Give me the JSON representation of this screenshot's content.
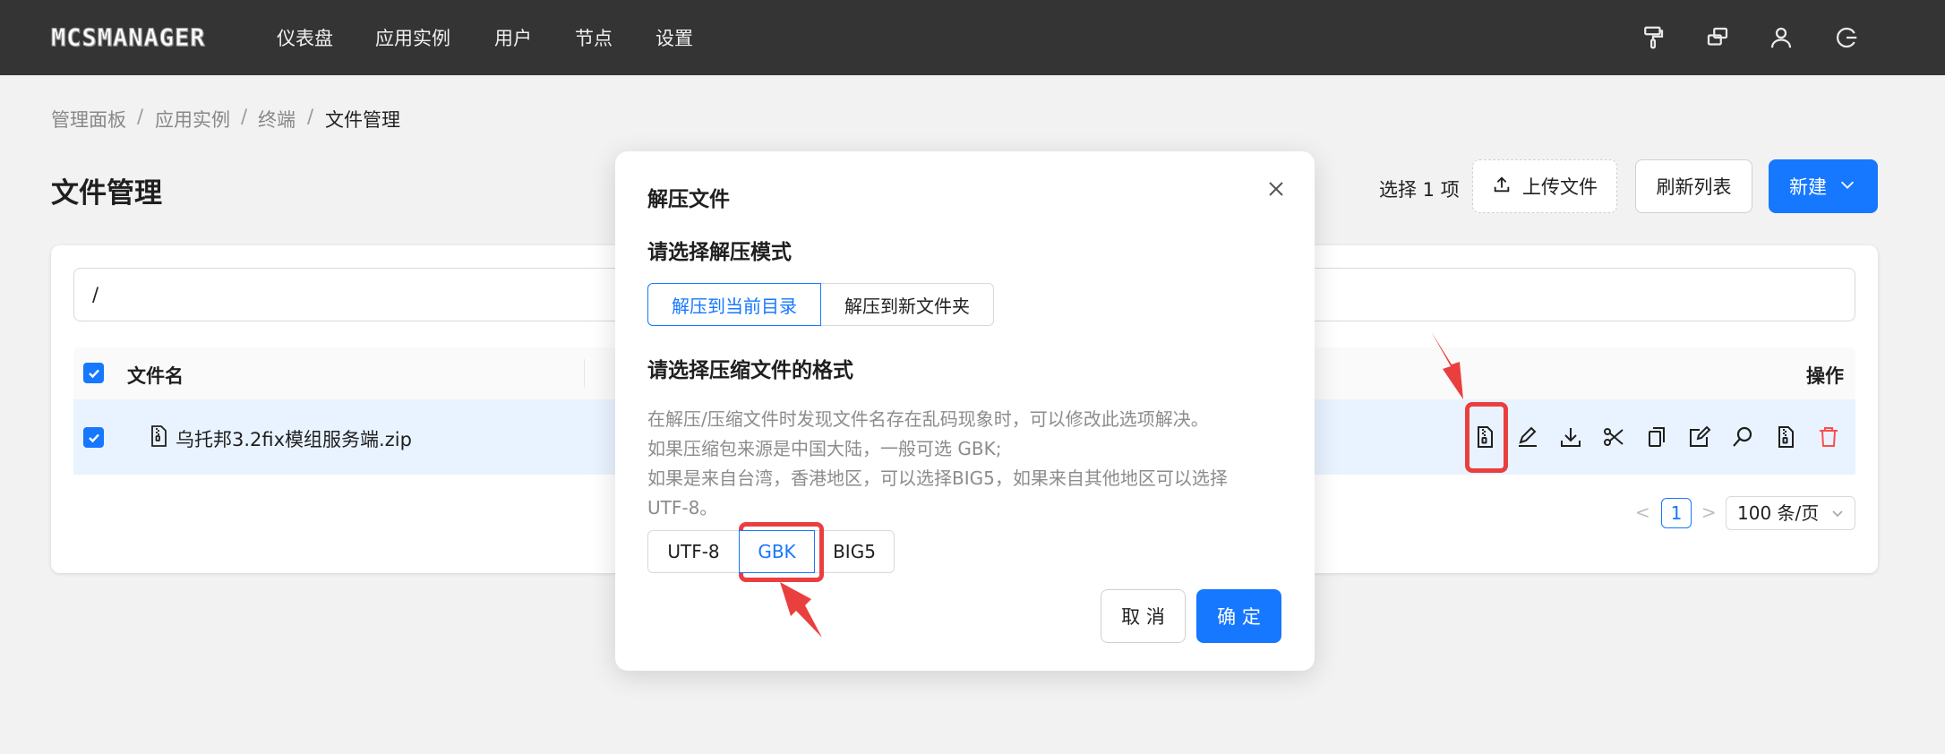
{
  "app": {
    "logo": "MCSMANAGER"
  },
  "nav": {
    "items": [
      "仪表盘",
      "应用实例",
      "用户",
      "节点",
      "设置"
    ]
  },
  "top_icons": [
    "paint-roller-icon",
    "layout-icon",
    "user-icon",
    "logout-icon"
  ],
  "breadcrumb": {
    "items": [
      "管理面板",
      "应用实例",
      "终端",
      "文件管理"
    ],
    "separator": "/"
  },
  "page": {
    "title": "文件管理"
  },
  "toolbar": {
    "selected": "选择 1 项",
    "upload": "上传文件",
    "refresh": "刷新列表",
    "new": "新建"
  },
  "file_panel": {
    "path": "/",
    "columns": {
      "name": "文件名",
      "actions": "操作"
    },
    "rows": [
      {
        "name": "乌托邦3.2fix模组服务端.zip",
        "checked": true
      }
    ],
    "row_actions": [
      "unzip-icon",
      "rename-icon",
      "download-icon",
      "cut-icon",
      "copy-icon",
      "edit-icon",
      "search-icon",
      "zip-icon",
      "delete-icon"
    ]
  },
  "pagination": {
    "prev": "<",
    "next": ">",
    "current": "1",
    "page_size": "100 条/页"
  },
  "modal": {
    "title": "解压文件",
    "mode_heading": "请选择解压模式",
    "modes": [
      "解压到当前目录",
      "解压到新文件夹"
    ],
    "mode_selected": "解压到当前目录",
    "format_heading": "请选择压缩文件的格式",
    "description": [
      "在解压/压缩文件时发现文件名存在乱码现象时，可以修改此选项解决。",
      "如果压缩包来源是中国大陆，一般可选 GBK;",
      "如果是来自台湾，香港地区，可以选择BIG5，如果来自其他地区可以选择",
      "UTF-8。"
    ],
    "encodings": [
      "UTF-8",
      "GBK",
      "BIG5"
    ],
    "encoding_selected": "GBK",
    "cancel": "取 消",
    "ok": "确 定"
  },
  "colors": {
    "primary": "#1677ff",
    "topbar": "#343434",
    "annotation": "#ea3f3f",
    "danger": "#ff4d4f"
  }
}
